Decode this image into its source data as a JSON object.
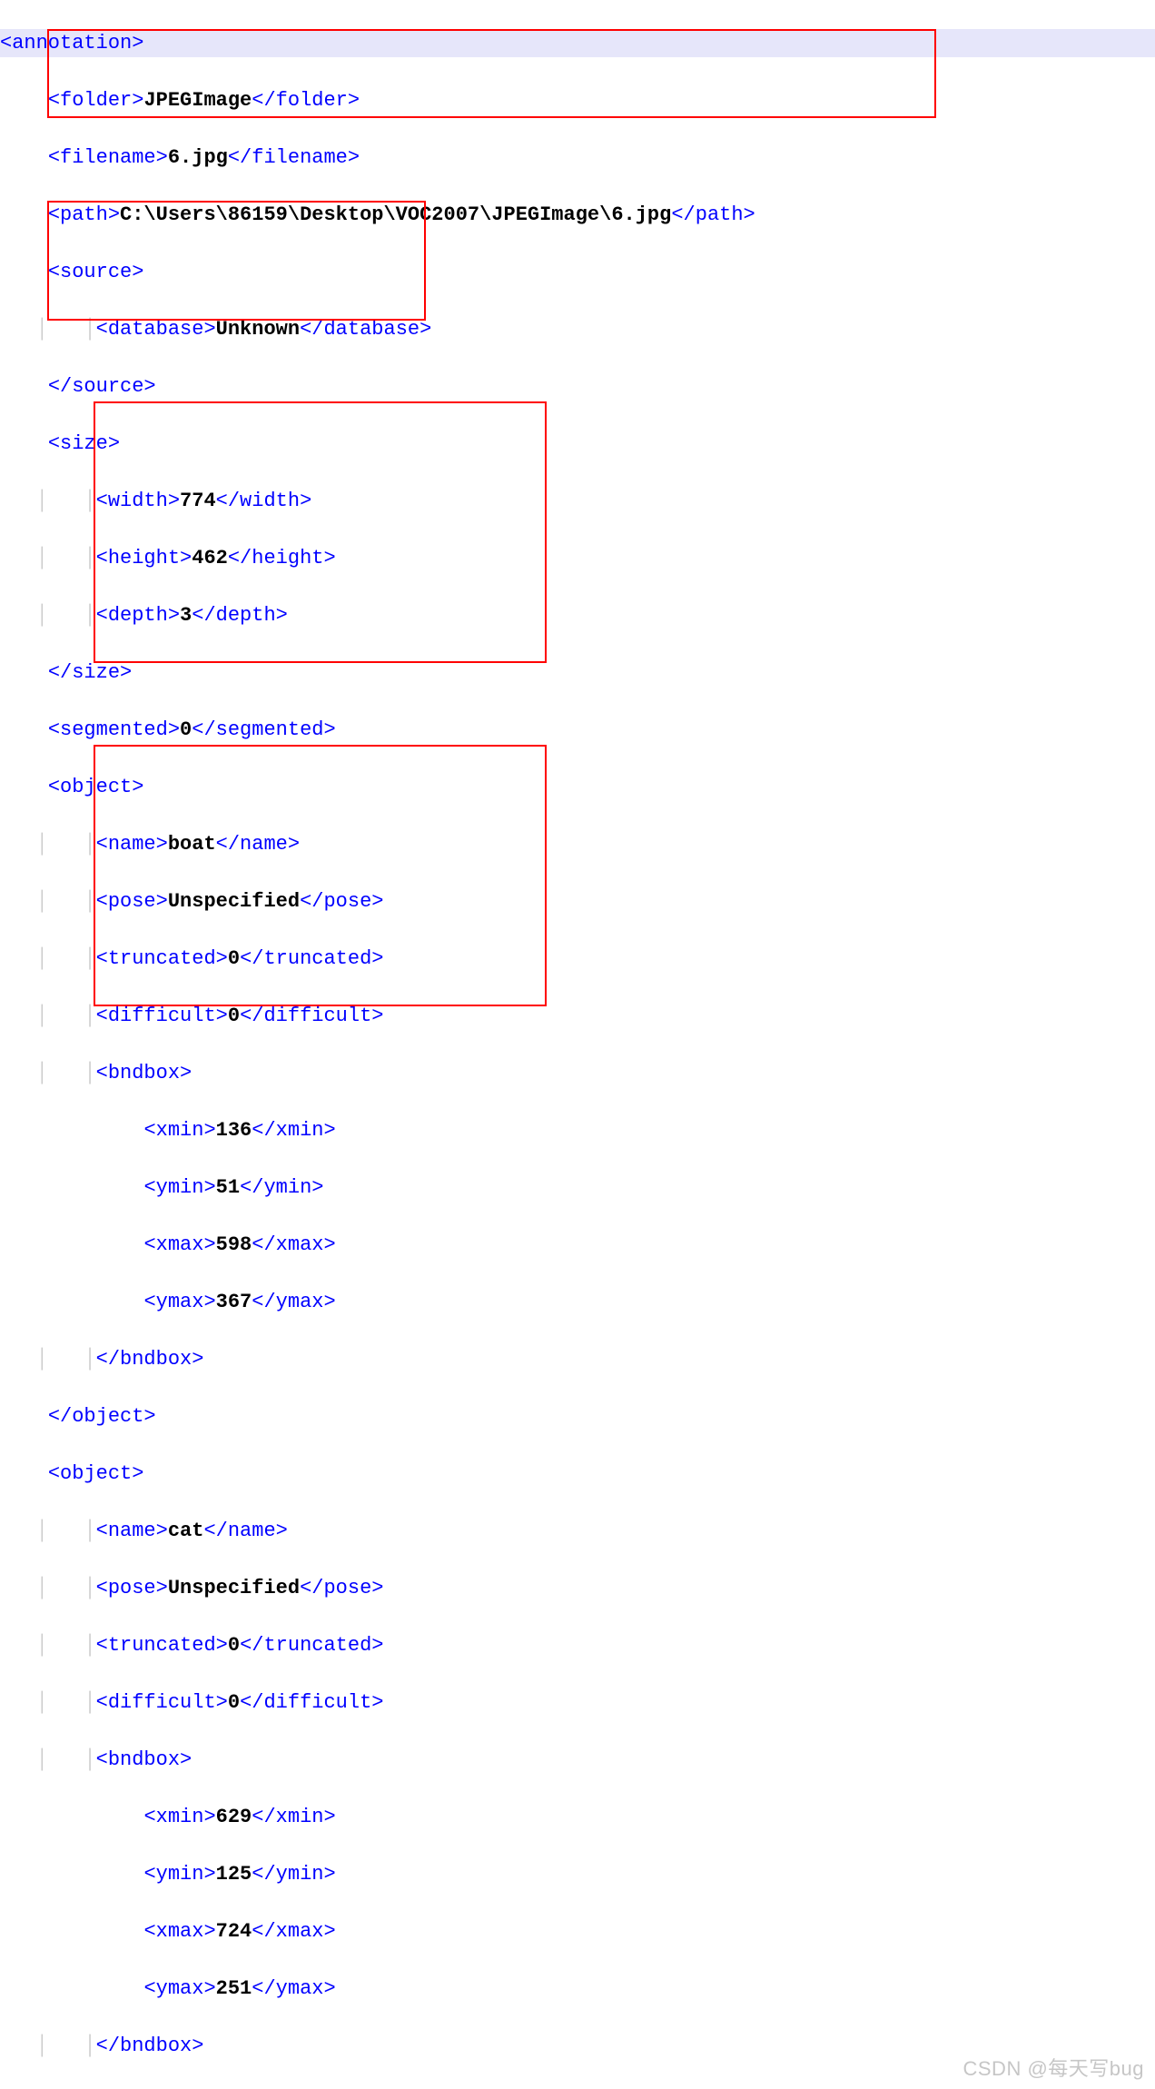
{
  "xml": {
    "root_open": "<annotation>",
    "folder": {
      "open": "<folder>",
      "val": "JPEGImage",
      "close": "</folder>"
    },
    "filename": {
      "open": "<filename>",
      "val": "6.jpg",
      "close": "</filename>"
    },
    "path": {
      "open": "<path>",
      "val": "C:\\Users\\86159\\Desktop\\VOC2007\\JPEGImage\\6.jpg",
      "close": "</path>"
    },
    "source": {
      "open": "<source>",
      "database": {
        "open": "<database>",
        "val": "Unknown",
        "close": "</database>"
      },
      "close": "</source>"
    },
    "size": {
      "open": "<size>",
      "width": {
        "open": "<width>",
        "val": "774",
        "close": "</width>"
      },
      "height": {
        "open": "<height>",
        "val": "462",
        "close": "</height>"
      },
      "depth": {
        "open": "<depth>",
        "val": "3",
        "close": "</depth>"
      },
      "close": "</size>"
    },
    "segmented": {
      "open": "<segmented>",
      "val": "0",
      "close": "</segmented>"
    },
    "obj1": {
      "open": "<object>",
      "name": {
        "open": "<name>",
        "val": "boat",
        "close": "</name>"
      },
      "pose": {
        "open": "<pose>",
        "val": "Unspecified",
        "close": "</pose>"
      },
      "truncated": {
        "open": "<truncated>",
        "val": "0",
        "close": "</truncated>"
      },
      "difficult": {
        "open": "<difficult>",
        "val": "0",
        "close": "</difficult>"
      },
      "bndbox": {
        "open": "<bndbox>",
        "xmin": {
          "open": "<xmin>",
          "val": "136",
          "close": "</xmin>"
        },
        "ymin": {
          "open": "<ymin>",
          "val": "51",
          "close": "</ymin>"
        },
        "xmax": {
          "open": "<xmax>",
          "val": "598",
          "close": "</xmax>"
        },
        "ymax": {
          "open": "<ymax>",
          "val": "367",
          "close": "</ymax>"
        },
        "close": "</bndbox>"
      },
      "close": "</object>"
    },
    "obj2": {
      "open": "<object>",
      "name": {
        "open": "<name>",
        "val": "cat",
        "close": "</name>"
      },
      "pose": {
        "open": "<pose>",
        "val": "Unspecified",
        "close": "</pose>"
      },
      "truncated": {
        "open": "<truncated>",
        "val": "0",
        "close": "</truncated>"
      },
      "difficult": {
        "open": "<difficult>",
        "val": "0",
        "close": "</difficult>"
      },
      "bndbox": {
        "open": "<bndbox>",
        "xmin": {
          "open": "<xmin>",
          "val": "629",
          "close": "</xmin>"
        },
        "ymin": {
          "open": "<ymin>",
          "val": "125",
          "close": "</ymin>"
        },
        "xmax": {
          "open": "<xmax>",
          "val": "724",
          "close": "</xmax>"
        },
        "ymax": {
          "open": "<ymax>",
          "val": "251",
          "close": "</ymax>"
        },
        "close": "</bndbox>"
      }
    }
  },
  "watermark": "CSDN @每天写bug",
  "ind": {
    "i1": "    ",
    "i1g": "   │",
    "i2": "        ",
    "i2g": "   │   │",
    "i3": "            "
  }
}
